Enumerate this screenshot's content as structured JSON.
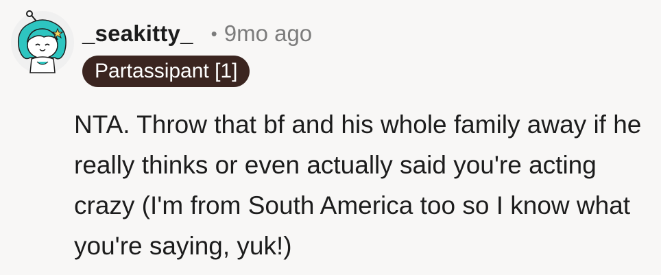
{
  "comment": {
    "author": "_seakitty_",
    "separator": "•",
    "timestamp": "9mo ago",
    "flair": "Partassipant [1]",
    "text": "NTA. Throw that bf and his whole family away if he really thinks or even actually said you're acting crazy (I'm from South America too so I know what you're saying, yuk!)"
  },
  "avatar": {
    "icon": "snoo-avatar-teal-hair",
    "colors": {
      "hair": "#2ec5c0",
      "face": "#ffffff",
      "outline": "#1c1c1c",
      "background": "#f0f0f0"
    }
  },
  "colors": {
    "background": "#f8f7f6",
    "username": "#1c1c1c",
    "meta": "#7c7c7c",
    "flair_bg": "#3b2520",
    "flair_text": "#ffffff",
    "text": "#1c1c1c"
  }
}
